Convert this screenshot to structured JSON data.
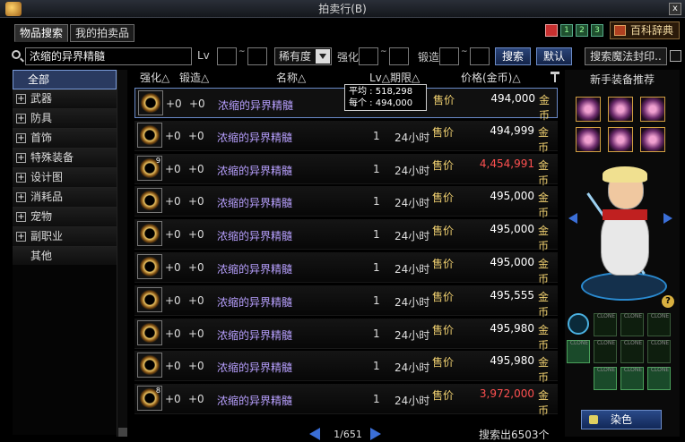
{
  "window": {
    "title": "拍卖行(B)",
    "close": "x"
  },
  "tabs": [
    {
      "label": "物品搜索"
    },
    {
      "label": "我的拍卖品"
    }
  ],
  "pages": [
    "1",
    "2",
    "3"
  ],
  "encyclopedia_label": "百科辞典",
  "search": {
    "query": "浓缩的异界精髓",
    "level_label": "Lv",
    "level_min": "",
    "level_max": "",
    "rarity_label": "稀有度",
    "enhance_label": "强化",
    "enhance_value": "",
    "forge_label": "锻造",
    "forge_value": "",
    "search_button": "搜索",
    "default_button": "默认",
    "magic_seal_label": "搜索魔法封印.."
  },
  "categories": [
    {
      "label": "全部",
      "expandable": false,
      "active": true
    },
    {
      "label": "武器",
      "expandable": true
    },
    {
      "label": "防具",
      "expandable": true
    },
    {
      "label": "首饰",
      "expandable": true
    },
    {
      "label": "特殊装备",
      "expandable": true
    },
    {
      "label": "设计图",
      "expandable": true
    },
    {
      "label": "消耗品",
      "expandable": true
    },
    {
      "label": "宠物",
      "expandable": true
    },
    {
      "label": "副职业",
      "expandable": true
    },
    {
      "label": "其他",
      "expandable": false
    }
  ],
  "columns": {
    "enhance": "强化△",
    "forge": "锻造△",
    "name": "名称△",
    "level_period": "Lv△期限△",
    "price": "价格(金币)△"
  },
  "tooltip": {
    "avg_label": "平均",
    "avg_value": "518,298",
    "each_label": "每个",
    "each_value": "494,000"
  },
  "listings": [
    {
      "stack": "",
      "enhance": "+0",
      "forge": "+0",
      "name": "浓缩的异界精髓",
      "level": "",
      "period": "",
      "type": "售价",
      "price": "494,000",
      "unit": "金币",
      "selected": true,
      "price_color": "#ffffff"
    },
    {
      "stack": "",
      "enhance": "+0",
      "forge": "+0",
      "name": "浓缩的异界精髓",
      "level": "1",
      "period": "24小时",
      "type": "售价",
      "price": "494,999",
      "unit": "金币",
      "price_color": "#ffffff"
    },
    {
      "stack": "9",
      "enhance": "+0",
      "forge": "+0",
      "name": "浓缩的异界精髓",
      "level": "1",
      "period": "24小时",
      "type": "售价",
      "price": "4,454,991",
      "unit": "金币",
      "price_color": "#ff5050"
    },
    {
      "stack": "",
      "enhance": "+0",
      "forge": "+0",
      "name": "浓缩的异界精髓",
      "level": "1",
      "period": "24小时",
      "type": "售价",
      "price": "495,000",
      "unit": "金币",
      "price_color": "#ffffff"
    },
    {
      "stack": "",
      "enhance": "+0",
      "forge": "+0",
      "name": "浓缩的异界精髓",
      "level": "1",
      "period": "24小时",
      "type": "售价",
      "price": "495,000",
      "unit": "金币",
      "price_color": "#ffffff"
    },
    {
      "stack": "",
      "enhance": "+0",
      "forge": "+0",
      "name": "浓缩的异界精髓",
      "level": "1",
      "period": "24小时",
      "type": "售价",
      "price": "495,000",
      "unit": "金币",
      "price_color": "#ffffff"
    },
    {
      "stack": "",
      "enhance": "+0",
      "forge": "+0",
      "name": "浓缩的异界精髓",
      "level": "1",
      "period": "24小时",
      "type": "售价",
      "price": "495,555",
      "unit": "金币",
      "price_color": "#ffffff"
    },
    {
      "stack": "",
      "enhance": "+0",
      "forge": "+0",
      "name": "浓缩的异界精髓",
      "level": "1",
      "period": "24小时",
      "type": "售价",
      "price": "495,980",
      "unit": "金币",
      "price_color": "#ffffff"
    },
    {
      "stack": "",
      "enhance": "+0",
      "forge": "+0",
      "name": "浓缩的异界精髓",
      "level": "1",
      "period": "24小时",
      "type": "售价",
      "price": "495,980",
      "unit": "金币",
      "price_color": "#ffffff"
    },
    {
      "stack": "8",
      "enhance": "+0",
      "forge": "+0",
      "name": "浓缩的异界精髓",
      "level": "1",
      "period": "24小时",
      "type": "售价",
      "price": "3,972,000",
      "unit": "金币",
      "price_color": "#ff5050"
    }
  ],
  "pager": {
    "text": "1/651"
  },
  "result_count": "搜索出6503个",
  "recommend": {
    "title": "新手装备推荐",
    "slot_label": "CLONE",
    "dye_button": "染色"
  }
}
